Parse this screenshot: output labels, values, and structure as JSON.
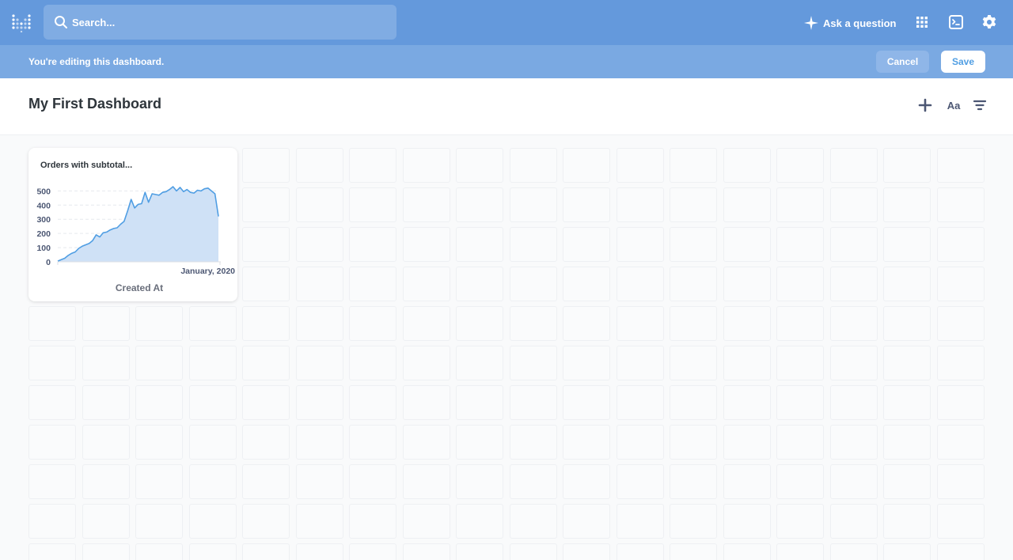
{
  "topbar": {
    "search_placeholder": "Search...",
    "ask_label": "Ask a question",
    "icons": [
      "metabase-logo-icon",
      "search-icon",
      "sparkle-icon",
      "apps-grid-icon",
      "sql-editor-icon",
      "gear-icon"
    ]
  },
  "banner": {
    "message": "You're editing this dashboard.",
    "cancel_label": "Cancel",
    "save_label": "Save"
  },
  "dashboard": {
    "title": "My First Dashboard",
    "toolbar_icons": [
      "add-icon",
      "text-box-icon",
      "filter-icon"
    ],
    "text_tool_label": "Aa"
  },
  "card": {
    "title": "Orders with subtotal...",
    "chart_data": {
      "type": "area",
      "title": "Orders with subtotal...",
      "xlabel": "Created At",
      "ylabel": "",
      "x_tick_labels": [
        "January, 2020"
      ],
      "y_ticks": [
        0,
        100,
        200,
        300,
        400,
        500
      ],
      "ylim": [
        0,
        530
      ],
      "grid": true,
      "series": [
        {
          "values": [
            5,
            15,
            25,
            45,
            60,
            70,
            95,
            110,
            120,
            130,
            150,
            190,
            175,
            205,
            210,
            225,
            235,
            240,
            265,
            285,
            360,
            440,
            380,
            405,
            410,
            490,
            420,
            480,
            475,
            470,
            490,
            495,
            510,
            530,
            500,
            525,
            495,
            510,
            490,
            485,
            505,
            500,
            515,
            520,
            500,
            480,
            320
          ]
        }
      ]
    }
  },
  "colors": {
    "topbar": "#6499dc",
    "banner": "#7aa9e2",
    "accent": "#509ee3",
    "area_fill": "#cfe1f6"
  }
}
